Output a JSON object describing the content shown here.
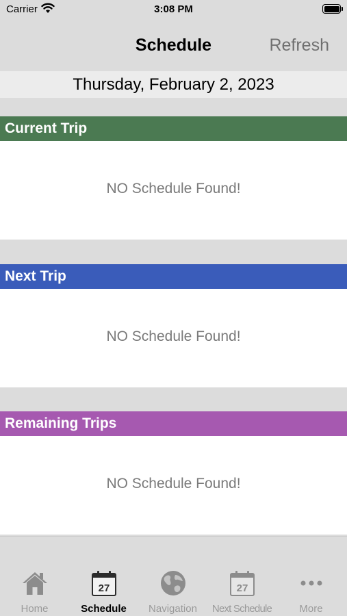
{
  "status_bar": {
    "carrier": "Carrier",
    "time": "3:08 PM"
  },
  "nav": {
    "title": "Schedule",
    "refresh_label": "Refresh"
  },
  "date": "Thursday, February 2, 2023",
  "sections": [
    {
      "title": "Current Trip",
      "color": "#4b7a52",
      "message": "NO Schedule Found!"
    },
    {
      "title": "Next Trip",
      "color": "#3a5cba",
      "message": "NO Schedule Found!"
    },
    {
      "title": "Remaining Trips",
      "color": "#a659b0",
      "message": "NO Schedule Found!"
    }
  ],
  "tabs": [
    {
      "label": "Home",
      "icon": "home-icon"
    },
    {
      "label": "Schedule",
      "icon": "calendar-icon",
      "badge": "27",
      "active": true
    },
    {
      "label": "Navigation",
      "icon": "globe-icon"
    },
    {
      "label": "Next Schedule",
      "icon": "calendar-icon",
      "badge": "27"
    },
    {
      "label": "More",
      "icon": "more-icon"
    }
  ]
}
